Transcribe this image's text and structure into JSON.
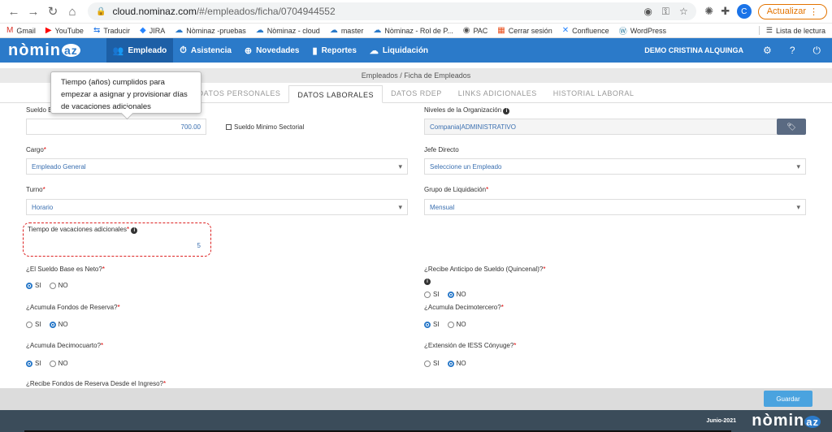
{
  "browser": {
    "url_host": "cloud.nominaz.com",
    "url_path": "/#/empleados/ficha/0704944552",
    "update_label": "Actualizar",
    "profile_initial": "C",
    "bookmarks": [
      {
        "icon": "M",
        "label": "Gmail"
      },
      {
        "icon": "▶",
        "label": "YouTube"
      },
      {
        "icon": "⇆",
        "label": "Traducir"
      },
      {
        "icon": "◆",
        "label": "JIRA"
      },
      {
        "icon": "☁",
        "label": "Nòminaz -pruebas"
      },
      {
        "icon": "☁",
        "label": "Nòminaz - cloud"
      },
      {
        "icon": "☁",
        "label": "master"
      },
      {
        "icon": "☁",
        "label": "Nòminaz - Rol de P..."
      },
      {
        "icon": "◉",
        "label": "PAC"
      },
      {
        "icon": "▦",
        "label": "Cerrar sesión"
      },
      {
        "icon": "✕",
        "label": "Confluence"
      },
      {
        "icon": "Ⓦ",
        "label": "WordPress"
      }
    ],
    "reading_list": "Lista de lectura"
  },
  "app": {
    "logo": "nòmin",
    "logo_suffix": "az",
    "nav": [
      {
        "icon": "👥",
        "label": "Empleado"
      },
      {
        "icon": "⏱",
        "label": "Asistencia"
      },
      {
        "icon": "⊕",
        "label": "Novedades"
      },
      {
        "icon": "▮",
        "label": "Reportes"
      },
      {
        "icon": "☁",
        "label": "Liquidación"
      }
    ],
    "user": "DEMO CRISTINA ALQUINGA"
  },
  "breadcrumb": "Empleados / Ficha de Empleados",
  "tabs": [
    "DATOS PERSONALES",
    "DATOS LABORALES",
    "DATOS RDEP",
    "LINKS ADICIONALES",
    "HISTORIAL LABORAL"
  ],
  "form": {
    "sueldo_label": "Sueldo Base (Jornada Completa)",
    "sueldo_value": "700.00",
    "sueldo_minimo_label": "Sueldo Minimo Sectorial",
    "niveles_label": "Niveles de la Organización",
    "niveles_value": "Compania|ADMINISTRATIVO",
    "cargo_label": "Cargo",
    "cargo_value": "Empleado General",
    "jefe_label": "Jefe Directo",
    "jefe_value": "Seleccione un Empleado",
    "turno_label": "Turno",
    "turno_value": "Horario",
    "grupo_label": "Grupo de Liquidación",
    "grupo_value": "Mensual",
    "vacaciones_label": "Tiempo de vacaciones adicionales",
    "vacaciones_value": "5",
    "neto_label": "¿El Sueldo Base es Neto?",
    "anticipo_label": "¿Recibe Anticipo de Sueldo (Quincenal)?",
    "fondos_label": "¿Acumula Fondos de Reserva?",
    "decimotercero_label": "¿Acumula Decimotercero?",
    "decimocuarto_label": "¿Acumula Decimocuarto?",
    "iess_label": "¿Extensión de IESS Cónyuge?",
    "fondos_ingreso_label": "¿Recibe Fondos de Reserva Desde el Ingreso?",
    "si": "SI",
    "no": "NO"
  },
  "tooltip": "Tiempo (años) cumplidos para empezar a asignar y provisionar días de vacaciones adicionales",
  "footer": {
    "save_label": "Guardar",
    "date": "Junio-2021",
    "logo": "nòmin",
    "logo_suffix": "az"
  }
}
